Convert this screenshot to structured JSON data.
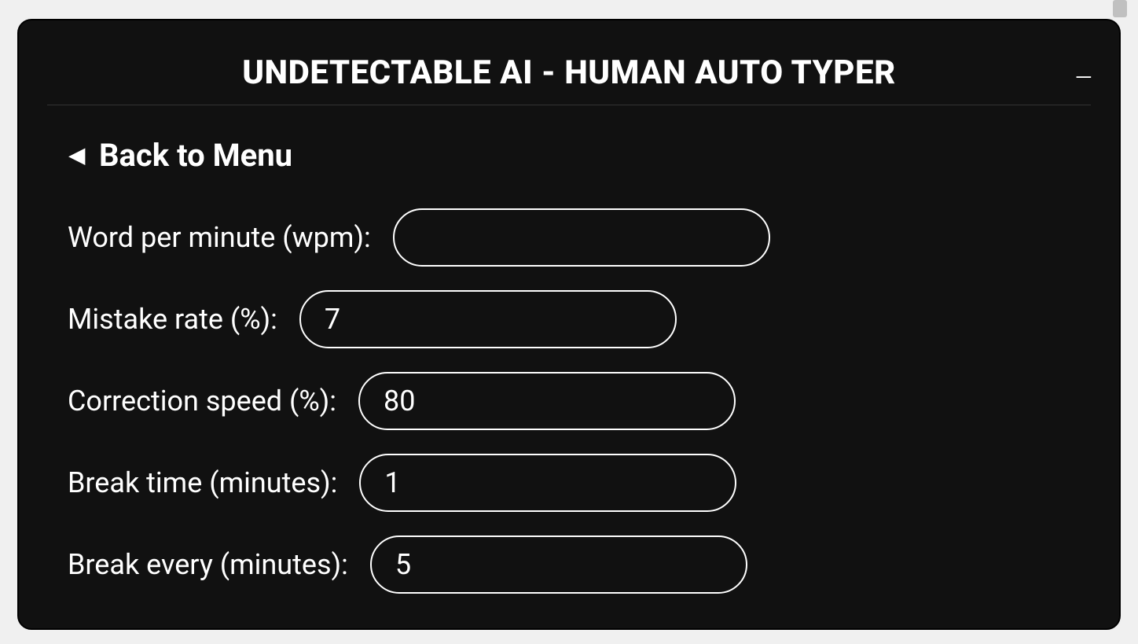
{
  "header": {
    "title": "UNDETECTABLE AI - HUMAN AUTO TYPER",
    "minimize_symbol": "–"
  },
  "back_link": {
    "arrow": "◀",
    "label": "Back to Menu"
  },
  "fields": {
    "wpm": {
      "label": "Word per minute (wpm):",
      "value": ""
    },
    "mistake_rate": {
      "label": "Mistake rate (%):",
      "value": "7"
    },
    "correction_speed": {
      "label": "Correction speed (%):",
      "value": "80"
    },
    "break_time": {
      "label": "Break time (minutes):",
      "value": "1"
    },
    "break_every": {
      "label": "Break every (minutes):",
      "value": "5"
    }
  }
}
